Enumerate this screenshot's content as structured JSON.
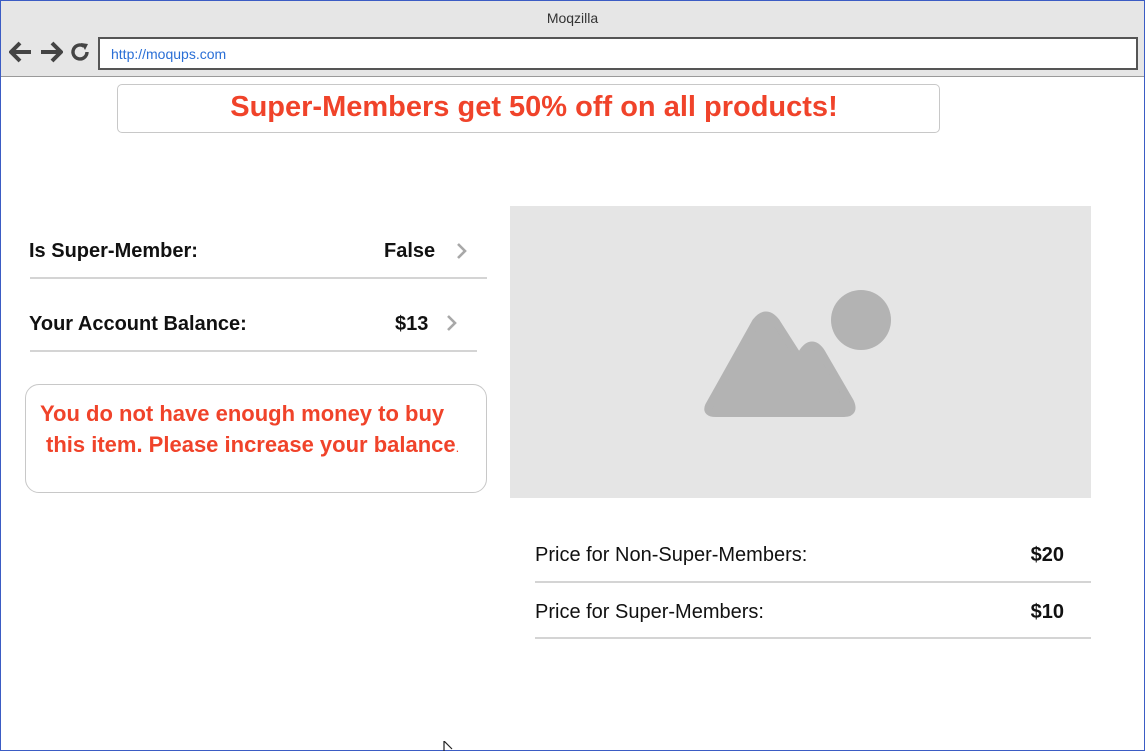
{
  "browser": {
    "window_title": "Moqzilla",
    "url": "http://moqups.com",
    "back_icon": "arrow-left-icon",
    "forward_icon": "arrow-right-icon",
    "reload_icon": "reload-icon"
  },
  "promo": {
    "text": "Super-Members get 50% off on all products!"
  },
  "account": {
    "super_member_label": "Is Super-Member:",
    "super_member_value": "False",
    "balance_label": "Your Account Balance:",
    "balance_value": "$13"
  },
  "warning": {
    "line1": "You do not have enough money to buy",
    "line2": "this item. Please increase your balance",
    "line2_end": "."
  },
  "product": {
    "image_icon": "image-placeholder-icon",
    "price_non_member_label": "Price for Non-Super-Members:",
    "price_non_member_value": "$20",
    "price_member_label": "Price for Super-Members:",
    "price_member_value": "$10"
  },
  "colors": {
    "accent_red": "#f0432a",
    "url_blue": "#2a6fd6",
    "window_border": "#3b5cc4",
    "placeholder_gray": "#e5e5e5",
    "placeholder_icon": "#b3b3b3"
  }
}
